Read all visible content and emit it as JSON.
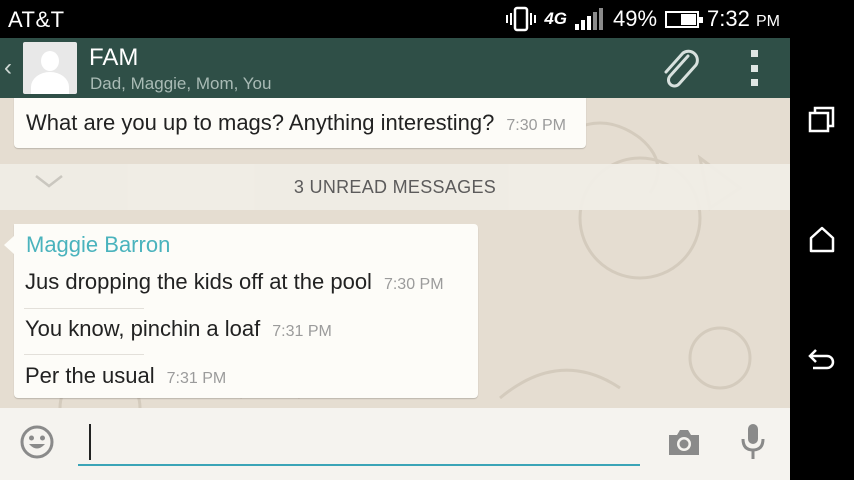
{
  "status_bar": {
    "carrier": "AT&T",
    "network": "4G",
    "battery_percent": "49%",
    "battery_level": 0.49,
    "time": "7:32",
    "ampm": "PM",
    "icons": [
      "vibrate-icon",
      "signal-icon",
      "battery-icon"
    ]
  },
  "header": {
    "back_icon": "chevron-left-icon",
    "title": "FAM",
    "subtitle": "Dad, Maggie, Mom, You",
    "avatar_icon": "group-avatar-icon",
    "attach_icon": "paperclip-icon",
    "menu_icon": "overflow-menu-icon"
  },
  "messages": {
    "outgoing_previous": {
      "text": "What are you up to mags? Anything interesting?",
      "time": "7:30 PM"
    },
    "unread_banner": "3 UNREAD MESSAGES",
    "incoming": {
      "sender": "Maggie Barron",
      "items": [
        {
          "text": "Jus dropping the kids off at the pool",
          "time": "7:30 PM"
        },
        {
          "text": "You know, pinchin a loaf",
          "time": "7:31 PM"
        },
        {
          "text": "Per the usual",
          "time": "7:31 PM"
        }
      ]
    }
  },
  "composer": {
    "value": "",
    "emoji_icon": "emoji-icon",
    "camera_icon": "camera-icon",
    "mic_icon": "microphone-icon"
  },
  "navigation": {
    "icons": [
      "recent-apps-icon",
      "home-icon",
      "back-icon"
    ]
  },
  "colors": {
    "action_bar": "#2f4f47",
    "sender_name": "#4ab3bd",
    "input_underline": "#3aa4b7",
    "chat_background": "#e5ddd1"
  }
}
